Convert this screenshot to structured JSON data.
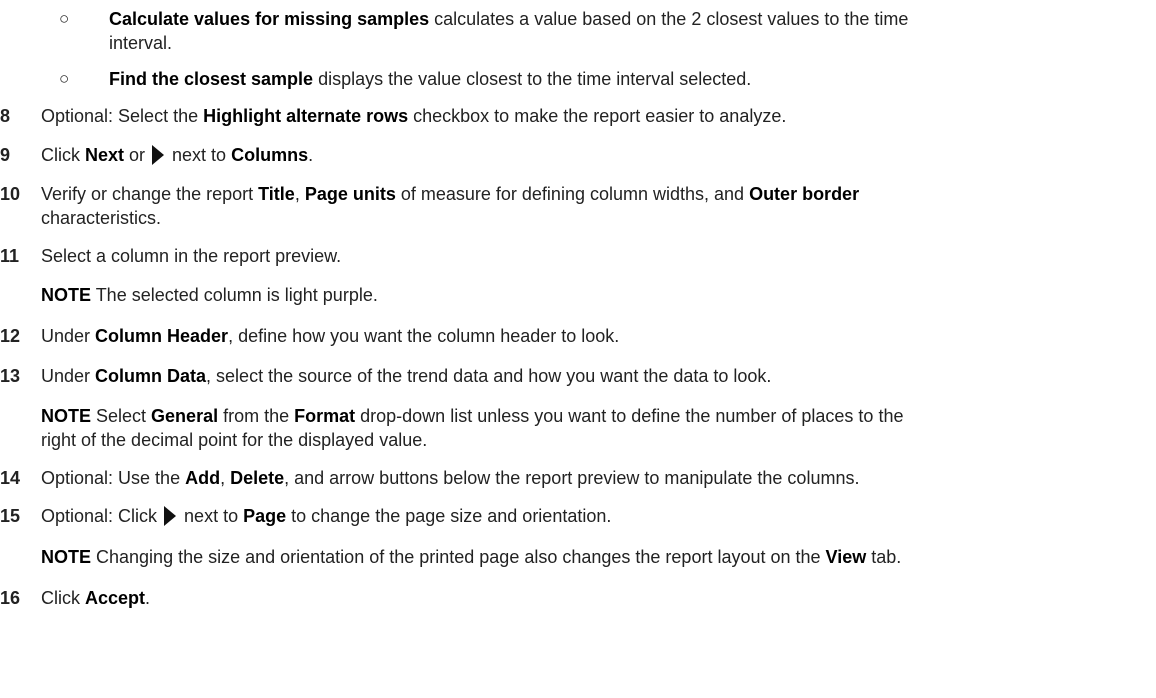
{
  "bullets": [
    {
      "symbol": "○",
      "strong": "Calculate values for missing samples",
      "text1": " calculates a value based on the 2 closest values to the time",
      "text2": "interval."
    },
    {
      "symbol": "○",
      "strong": "Find the closest sample",
      "text1": " displays the value closest to the time interval selected."
    }
  ],
  "steps": {
    "s8": {
      "num": "8",
      "a": "Optional:  Select the ",
      "b": "Highlight alternate rows",
      "c": " checkbox to make the report easier to analyze."
    },
    "s9": {
      "num": "9",
      "a": "Click ",
      "b": "Next",
      "c": " or ",
      "d": " next to ",
      "e": "Columns",
      "f": ".",
      "icon": "play-arrow-icon"
    },
    "s10": {
      "num": "10",
      "a": "Verify or change the report ",
      "b": "Title",
      "c": ", ",
      "d": "Page units",
      "e": " of measure for defining column widths, and ",
      "f": "Outer border",
      "g": "characteristics."
    },
    "s11": {
      "num": "11",
      "a": "Select a column in the report preview.",
      "note_label": "NOTE",
      "note_text": "  The selected column is light purple."
    },
    "s12": {
      "num": "12",
      "a": "Under ",
      "b": "Column Header",
      "c": ", define how you want the column header to look."
    },
    "s13": {
      "num": "13",
      "a": "Under ",
      "b": "Column Data",
      "c": ", select the source of the trend data and how you want the data to look.",
      "note_label": "NOTE",
      "note_a": "  Select ",
      "note_b": "General",
      "note_c": " from the ",
      "note_d": "Format",
      "note_e": " drop-down list unless you want to define the number of places to the",
      "note_f": "right of the decimal point for the displayed value."
    },
    "s14": {
      "num": "14",
      "a": "Optional:  Use the ",
      "b": "Add",
      "c": ", ",
      "d": "Delete",
      "e": ", and arrow buttons below the report preview to manipulate the columns."
    },
    "s15": {
      "num": "15",
      "a": "Optional:  Click ",
      "b": " next to ",
      "c": "Page",
      "d": " to change the page size and orientation.",
      "icon": "play-arrow-icon",
      "note_label": "NOTE",
      "note_a": "  Changing the size and orientation of the printed page also changes the report layout on the ",
      "note_b": "View",
      "note_c": " tab."
    },
    "s16": {
      "num": "16",
      "a": "Click ",
      "b": "Accept",
      "c": "."
    }
  }
}
